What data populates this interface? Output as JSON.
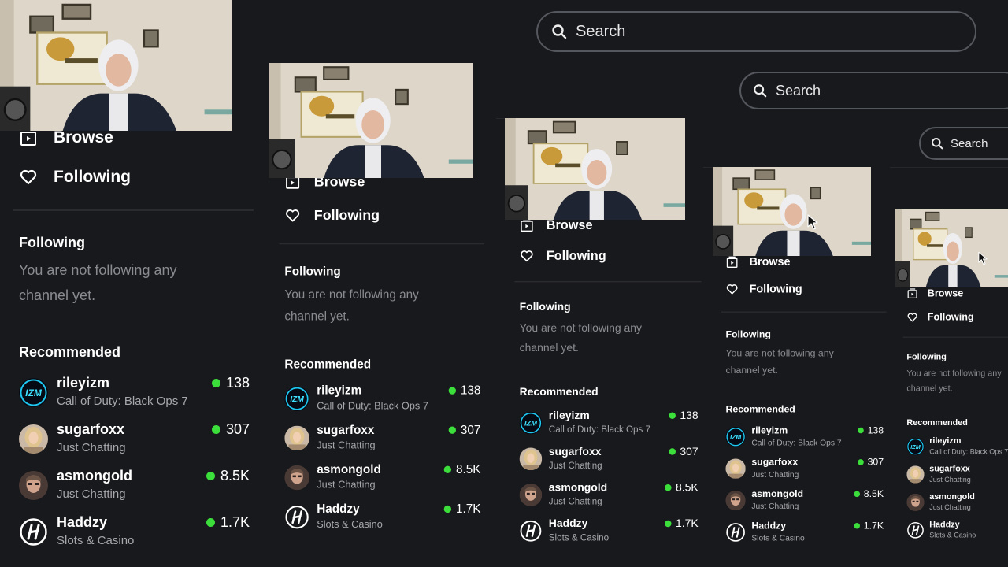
{
  "search": {
    "placeholder": "Search"
  },
  "nav": [
    {
      "label": "Browse",
      "icon": "browse-icon"
    },
    {
      "label": "Following",
      "icon": "heart-icon"
    }
  ],
  "following_section": {
    "title": "Following",
    "empty_text": "You are not following any channel yet."
  },
  "recommended_section": {
    "title": "Recommended",
    "channels": [
      {
        "name": "rileyizm",
        "category": "Call of Duty: Black Ops 7",
        "viewers": "138",
        "avatar": "rileyizm-avatar"
      },
      {
        "name": "sugarfoxx",
        "category": "Just Chatting",
        "viewers": "307",
        "avatar": "sugarfoxx-avatar"
      },
      {
        "name": "asmongold",
        "category": "Just Chatting",
        "viewers": "8.5K",
        "avatar": "asmongold-avatar"
      },
      {
        "name": "Haddzy",
        "category": "Slots & Casino",
        "viewers": "1.7K",
        "avatar": "haddzy-avatar"
      }
    ]
  },
  "colors": {
    "background": "#18191c",
    "live_dot": "#3bde3b",
    "muted_text": "#8a8b91",
    "category_text": "#a7a8ad"
  },
  "overlay": {
    "webcam": "webcam-feed",
    "cursor": "mouse-cursor"
  }
}
